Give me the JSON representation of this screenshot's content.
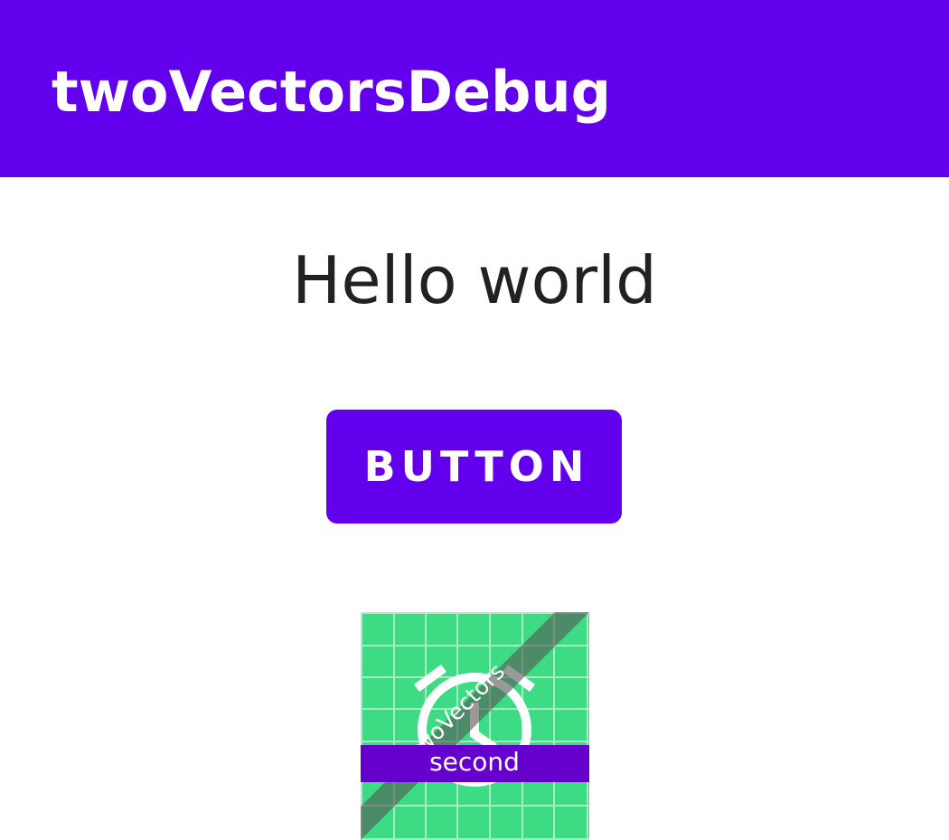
{
  "app_bar": {
    "title": "twoVectorsDebug",
    "color": "#6200ee"
  },
  "main": {
    "greeting": "Hello world",
    "button_label": "BUTTON"
  },
  "launcher_icon": {
    "icon": "alarm-clock-icon",
    "ribbon_label": "twoVectors",
    "banner_label": "second",
    "background_color": "#3ddc84",
    "banner_color": "#6600cc"
  }
}
